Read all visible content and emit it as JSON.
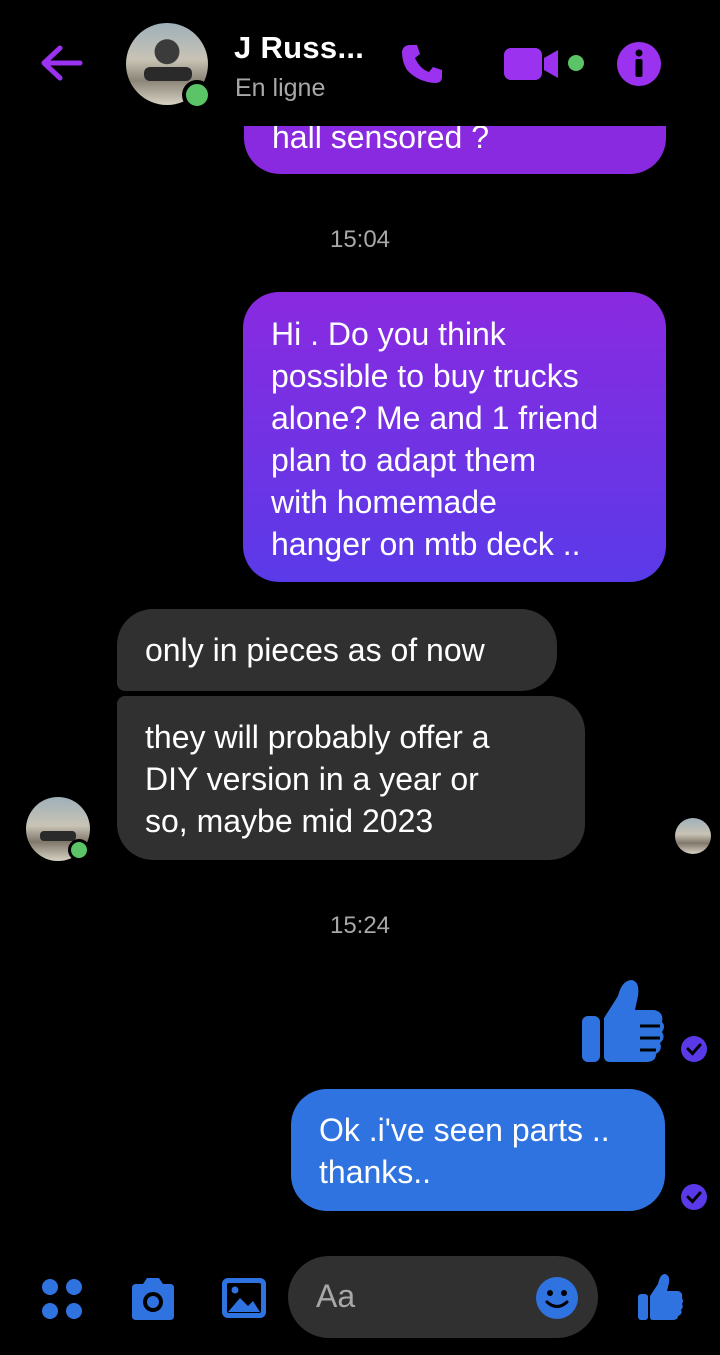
{
  "header": {
    "contact_name": "J Russ...",
    "presence_status": "En ligne",
    "icons": {
      "back": "arrow-left-icon",
      "call": "phone-icon",
      "video": "video-camera-icon",
      "info": "info-icon"
    }
  },
  "messages": [
    {
      "type": "sent",
      "lines": [
        "hall sensored ?"
      ]
    },
    {
      "type": "timestamp",
      "text": "15:04"
    },
    {
      "type": "sent",
      "lines": [
        "Hi . Do you think",
        "possible to buy trucks",
        "alone? Me and 1 friend",
        "plan to adapt them",
        "with homemade",
        "hanger on mtb deck .."
      ]
    },
    {
      "type": "received",
      "lines": [
        "only in pieces as of now"
      ]
    },
    {
      "type": "received",
      "lines": [
        "they will probably offer a",
        "DIY version in a year or",
        "so, maybe mid 2023"
      ]
    },
    {
      "type": "timestamp",
      "text": "15:24"
    },
    {
      "type": "sent-like",
      "icon": "thumbs-up-icon"
    },
    {
      "type": "sent",
      "lines": [
        "Ok .i've seen parts ..",
        "thanks.."
      ]
    }
  ],
  "composer": {
    "placeholder": "Aa",
    "icons": [
      "grid-menu-icon",
      "camera-icon",
      "gallery-icon",
      "emoji-icon",
      "thumbs-up-icon"
    ]
  },
  "colors": {
    "background": "#000000",
    "accent_purple": "#8a2ae0",
    "accent_blue": "#2f73e0",
    "received_bubble": "#303030",
    "online_green": "#5ac466",
    "muted_text": "#a8a8a8"
  }
}
